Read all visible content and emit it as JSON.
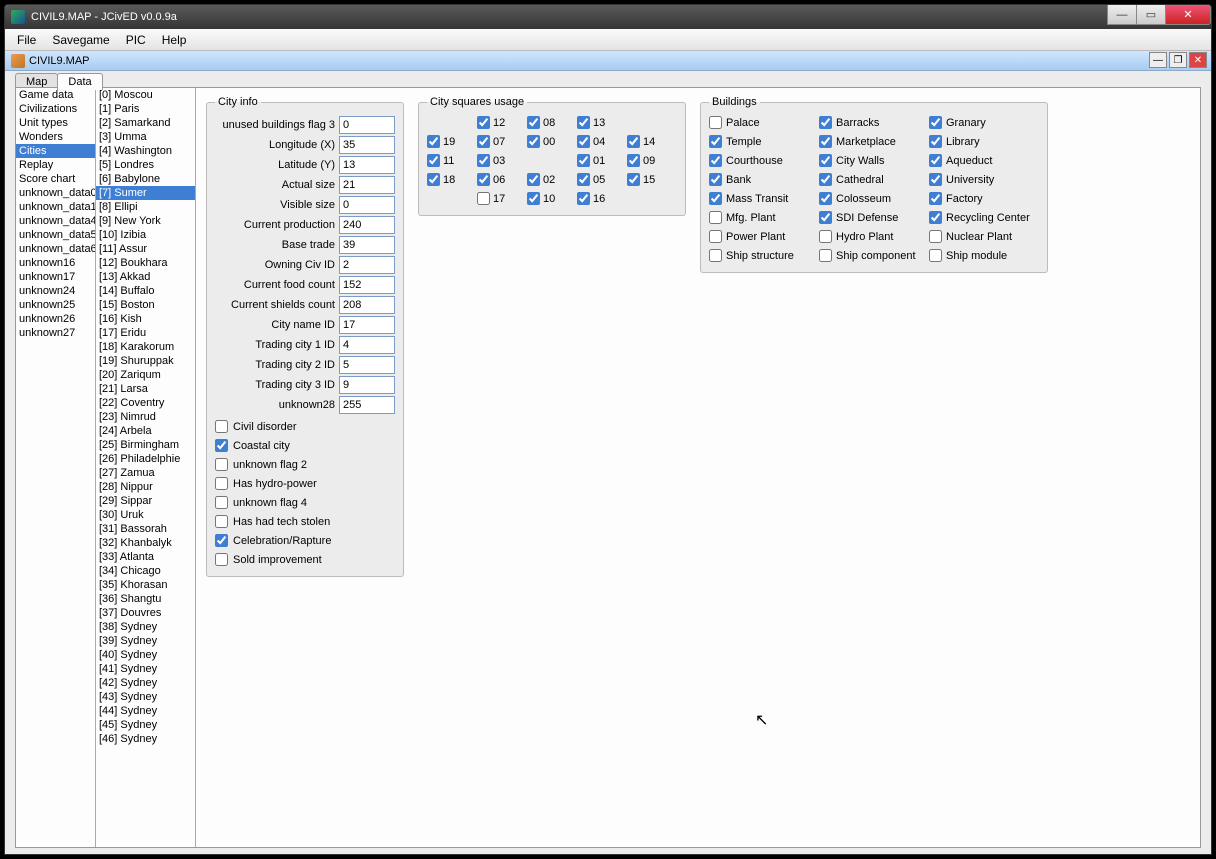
{
  "window": {
    "title": "CIVIL9.MAP - JCivED v0.0.9a"
  },
  "menu": [
    "File",
    "Savegame",
    "PIC",
    "Help"
  ],
  "doc": {
    "title": "CIVIL9.MAP"
  },
  "tabs": {
    "map": "Map",
    "data": "Data"
  },
  "leftList": [
    "Game data",
    "Civilizations",
    "Unit types",
    "Wonders",
    "Cities",
    "Replay",
    "Score chart",
    "unknown_data0",
    "unknown_data1",
    "unknown_data4",
    "unknown_data5",
    "unknown_data6",
    "unknown16",
    "unknown17",
    "unknown24",
    "unknown25",
    "unknown26",
    "unknown27"
  ],
  "leftListSelected": 4,
  "cityList": [
    "[0] Moscou",
    "[1] Paris",
    "[2] Samarkand",
    "[3] Umma",
    "[4] Washington",
    "[5] Londres",
    "[6] Babylone",
    "[7] Sumer",
    "[8] Ellipi",
    "[9] New York",
    "[10] Izibia",
    "[11] Assur",
    "[12] Boukhara",
    "[13] Akkad",
    "[14] Buffalo",
    "[15] Boston",
    "[16] Kish",
    "[17] Eridu",
    "[18] Karakorum",
    "[19] Shuruppak",
    "[20] Zariqum",
    "[21] Larsa",
    "[22] Coventry",
    "[23] Nimrud",
    "[24] Arbela",
    "[25] Birmingham",
    "[26] Philadelphie",
    "[27] Zamua",
    "[28] Nippur",
    "[29] Sippar",
    "[30] Uruk",
    "[31] Bassorah",
    "[32] Khanbalyk",
    "[33] Atlanta",
    "[34] Chicago",
    "[35] Khorasan",
    "[36] Shangtu",
    "[37] Douvres",
    "[38] Sydney",
    "[39] Sydney",
    "[40] Sydney",
    "[41] Sydney",
    "[42] Sydney",
    "[43] Sydney",
    "[44] Sydney",
    "[45] Sydney",
    "[46] Sydney"
  ],
  "cityListSelected": 7,
  "cityInfo": {
    "legend": "City info",
    "fields": [
      {
        "label": "unused buildings flag 3",
        "value": "0"
      },
      {
        "label": "Longitude (X)",
        "value": "35"
      },
      {
        "label": "Latitude (Y)",
        "value": "13"
      },
      {
        "label": "Actual size",
        "value": "21"
      },
      {
        "label": "Visible size",
        "value": "0"
      },
      {
        "label": "Current production",
        "value": "240"
      },
      {
        "label": "Base trade",
        "value": "39"
      },
      {
        "label": "Owning Civ ID",
        "value": "2"
      },
      {
        "label": "Current food count",
        "value": "152"
      },
      {
        "label": "Current shields count",
        "value": "208"
      },
      {
        "label": "City name ID",
        "value": "17"
      },
      {
        "label": "Trading city 1 ID",
        "value": "4"
      },
      {
        "label": "Trading city 2 ID",
        "value": "5"
      },
      {
        "label": "Trading city 3 ID",
        "value": "9"
      },
      {
        "label": "unknown28",
        "value": "255"
      }
    ],
    "flags": [
      {
        "label": "Civil disorder",
        "checked": false
      },
      {
        "label": "Coastal city",
        "checked": true
      },
      {
        "label": "unknown flag 2",
        "checked": false
      },
      {
        "label": "Has hydro-power",
        "checked": false
      },
      {
        "label": "unknown flag 4",
        "checked": false
      },
      {
        "label": "Has had tech stolen",
        "checked": false
      },
      {
        "label": "Celebration/Rapture",
        "checked": true
      },
      {
        "label": "Sold improvement",
        "checked": false
      }
    ]
  },
  "squares": {
    "legend": "City squares usage",
    "rows": [
      [
        null,
        {
          "n": "12",
          "c": true
        },
        {
          "n": "08",
          "c": true
        },
        {
          "n": "13",
          "c": true
        },
        null
      ],
      [
        {
          "n": "19",
          "c": true
        },
        {
          "n": "07",
          "c": true
        },
        {
          "n": "00",
          "c": true
        },
        {
          "n": "04",
          "c": true
        },
        {
          "n": "14",
          "c": true
        }
      ],
      [
        {
          "n": "11",
          "c": true
        },
        {
          "n": "03",
          "c": true
        },
        null,
        {
          "n": "01",
          "c": true
        },
        {
          "n": "09",
          "c": true
        }
      ],
      [
        {
          "n": "18",
          "c": true
        },
        {
          "n": "06",
          "c": true
        },
        {
          "n": "02",
          "c": true
        },
        {
          "n": "05",
          "c": true
        },
        {
          "n": "15",
          "c": true
        }
      ],
      [
        null,
        {
          "n": "17",
          "c": false
        },
        {
          "n": "10",
          "c": true
        },
        {
          "n": "16",
          "c": true
        },
        null
      ]
    ]
  },
  "buildings": {
    "legend": "Buildings",
    "items": [
      {
        "label": "Palace",
        "checked": false
      },
      {
        "label": "Barracks",
        "checked": true
      },
      {
        "label": "Granary",
        "checked": true
      },
      {
        "label": "Temple",
        "checked": true
      },
      {
        "label": "Marketplace",
        "checked": true
      },
      {
        "label": "Library",
        "checked": true
      },
      {
        "label": "Courthouse",
        "checked": true
      },
      {
        "label": "City Walls",
        "checked": true
      },
      {
        "label": "Aqueduct",
        "checked": true
      },
      {
        "label": "Bank",
        "checked": true
      },
      {
        "label": "Cathedral",
        "checked": true
      },
      {
        "label": "University",
        "checked": true
      },
      {
        "label": "Mass Transit",
        "checked": true
      },
      {
        "label": "Colosseum",
        "checked": true
      },
      {
        "label": "Factory",
        "checked": true
      },
      {
        "label": "Mfg. Plant",
        "checked": false
      },
      {
        "label": "SDI Defense",
        "checked": true
      },
      {
        "label": "Recycling Center",
        "checked": true
      },
      {
        "label": "Power Plant",
        "checked": false
      },
      {
        "label": "Hydro Plant",
        "checked": false
      },
      {
        "label": "Nuclear Plant",
        "checked": false
      },
      {
        "label": "Ship structure",
        "checked": false
      },
      {
        "label": "Ship component",
        "checked": false
      },
      {
        "label": "Ship module",
        "checked": false
      }
    ]
  }
}
